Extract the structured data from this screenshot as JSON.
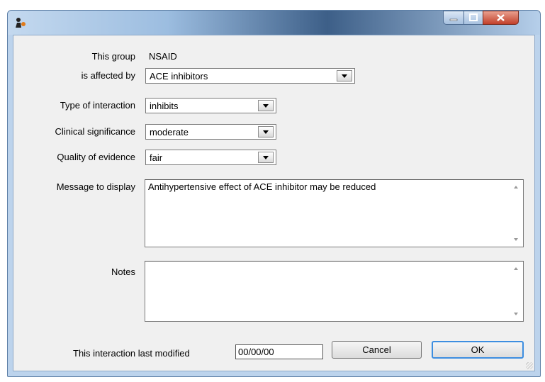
{
  "window": {
    "icon": "app-figure-icon",
    "controls": {
      "minimize": "minimize-icon",
      "maximize": "maximize-icon",
      "close": "close-icon",
      "close_color": "#c2402a"
    }
  },
  "form": {
    "group_label": "This group",
    "group_value": "NSAID",
    "affected_label": "is affected by",
    "affected_value": "ACE inhibitors",
    "interaction_type_label": "Type of interaction",
    "interaction_type_value": "inhibits",
    "significance_label": "Clinical significance",
    "significance_value": "moderate",
    "evidence_label": "Quality of evidence",
    "evidence_value": "fair",
    "message_label": "Message to display",
    "message_value": "Antihypertensive effect of ACE inhibitor may be reduced",
    "notes_label": "Notes",
    "notes_value": "",
    "modified_label": "This interaction last modified",
    "modified_value": "00/00/00"
  },
  "buttons": {
    "cancel": "Cancel",
    "ok": "OK"
  },
  "colors": {
    "title_gradient_dark": "#3d5f88",
    "default_button_border": "#3d8ee0",
    "client_bg": "#f0f0f0"
  }
}
